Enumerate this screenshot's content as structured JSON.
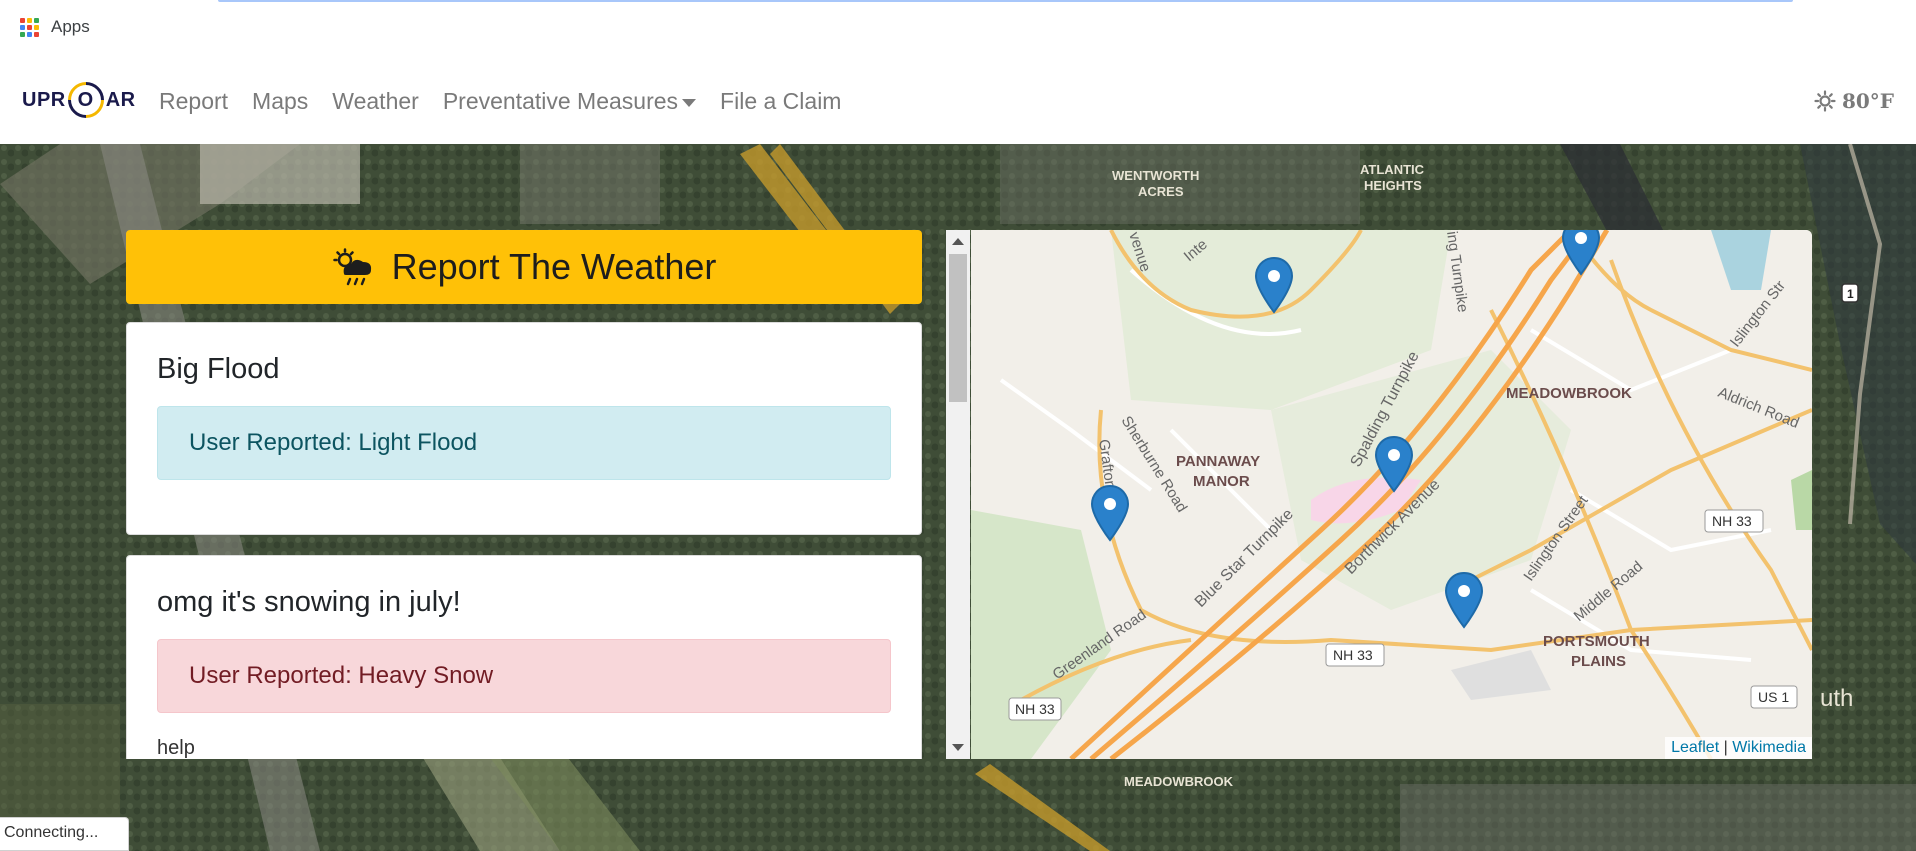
{
  "browser": {
    "apps_label": "Apps"
  },
  "navbar": {
    "brand": {
      "part1": "UPR",
      "o": "O",
      "part2": "AR"
    },
    "links": [
      {
        "label": "Report"
      },
      {
        "label": "Maps"
      },
      {
        "label": "Weather"
      },
      {
        "label": "Preventative Measures",
        "dropdown": true
      },
      {
        "label": "File a Claim"
      }
    ],
    "temperature": "80°F",
    "temperature_icon": "sun-icon"
  },
  "report": {
    "header_label": "Report The Weather",
    "header_icon": "cloud-sun-rain-icon",
    "header_color": "#ffc107",
    "cards": [
      {
        "title": "Big Flood",
        "alert": "User Reported: Light Flood",
        "alert_type": "info"
      },
      {
        "title": "omg it's snowing in july!",
        "alert": "User Reported: Heavy Snow",
        "alert_type": "danger",
        "body": "help"
      }
    ]
  },
  "map": {
    "labels": {
      "meadowbrook": "MEADOWBROOK",
      "pannaway1": "PANNAWAY",
      "pannaway2": "MANOR",
      "portsmouth1": "PORTSMOUTH",
      "portsmouth2": "PLAINS",
      "sherburne": "Sherburne Road",
      "grafton": "Grafton Drive",
      "spalding": "Spalding Turnpike",
      "bluestar": "Blue Star Turnpike",
      "borthwick": "Borthwick Avenue",
      "islington": "Islington Street",
      "islington_str": "Islington Str",
      "aldrich": "Aldrich Road",
      "middle": "Middle Road",
      "greenland": "Greenland Road",
      "avenue": "venue",
      "inte": "Inte",
      "turnpike_top": "ing Turnpike",
      "nh33_a": "NH 33",
      "nh33_b": "NH 33",
      "nh33_c": "NH 33",
      "us1": "US 1"
    },
    "attribution": {
      "leaflet": "Leaflet",
      "sep": "|",
      "wikimedia": "Wikimedia"
    },
    "marker_count": 5
  },
  "satellite": {
    "labels": {
      "wentworth1": "WENTWORTH",
      "wentworth2": "ACRES",
      "atlantic1": "ATLANTIC",
      "atlantic2": "HEIGHTS",
      "meadowbrook_bottom": "MEADOWBROOK",
      "south": "uth",
      "route": "1"
    }
  },
  "status_text": "Connecting..."
}
